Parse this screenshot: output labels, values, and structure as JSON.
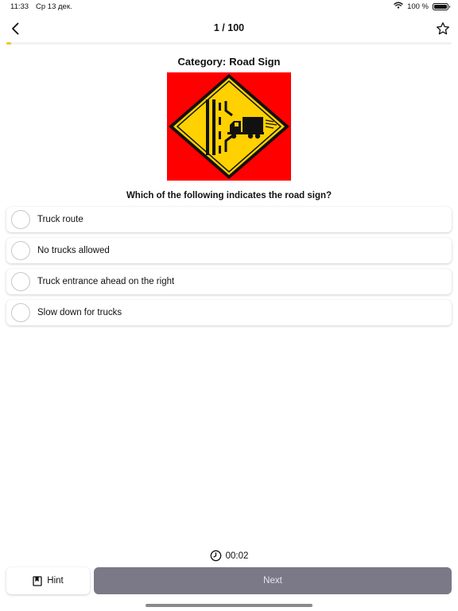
{
  "status_bar": {
    "time": "11:33",
    "date": "Ср 13 дек.",
    "battery": "100 %",
    "battery_level": 1.0
  },
  "nav": {
    "title": "1 / 100",
    "back_icon": "chevron-left-icon",
    "favorite_icon": "star-outline-icon"
  },
  "progress": {
    "current": 1,
    "total": 100,
    "color": "#f5c518"
  },
  "question_card": {
    "category_label": "Category:",
    "category": "Road Sign",
    "sign": {
      "background": "#ff0000",
      "diamond_fill": "#ffd100",
      "symbol": "truck-entering-road"
    },
    "question": "Which of the following indicates the road sign?"
  },
  "options": [
    {
      "label": "Truck route"
    },
    {
      "label": "No trucks allowed"
    },
    {
      "label": "Truck entrance ahead on the right"
    },
    {
      "label": "Slow down for trucks"
    }
  ],
  "timer": {
    "icon": "clock-icon",
    "value": "00:02"
  },
  "actions": {
    "hint_label": "Hint",
    "hint_icon": "bookmark-icon",
    "next_label": "Next",
    "next_color": "#7b7887"
  }
}
